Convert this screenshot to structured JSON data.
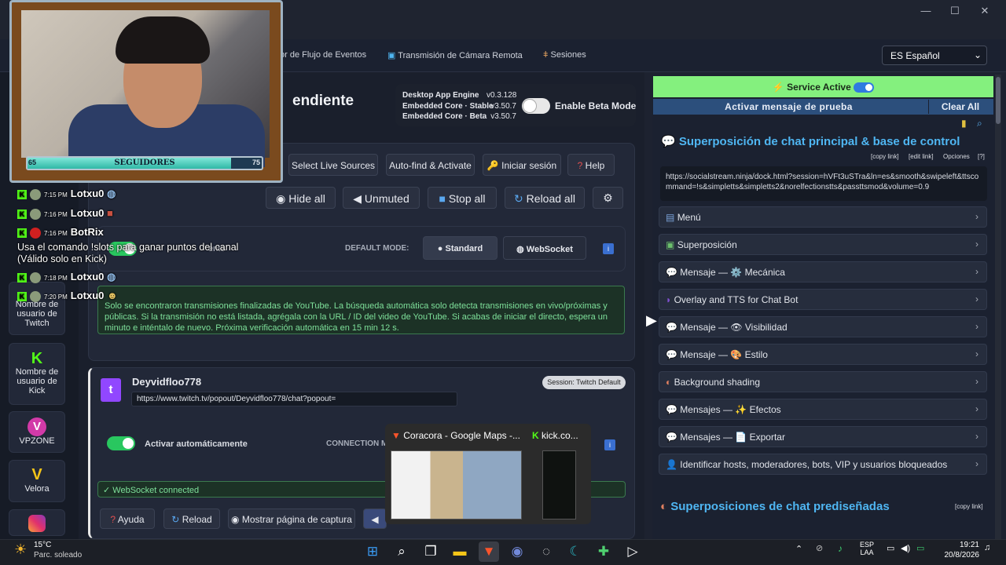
{
  "window": {
    "minimize": "—",
    "maximize": "☐",
    "close": "✕"
  },
  "nav": {
    "links": [
      "or de Flujo de Eventos",
      "Transmisión de Cámara Remota",
      "Sesiones"
    ],
    "language": "ES Español"
  },
  "webcam": {
    "follow_left": "65",
    "follow_label": "SEGUIDORES",
    "follow_right": "75",
    "progress": 0.87
  },
  "sidebar": {
    "items": [
      {
        "label": "Nombre de usuario de Twitch",
        "icon": "twitch-icon"
      },
      {
        "label": "Nombre de usuario de Kick",
        "icon": "kick-icon"
      },
      {
        "label": "VPZONE",
        "icon": "vpzone-icon"
      },
      {
        "label": "Velora",
        "icon": "velora-icon"
      }
    ]
  },
  "main": {
    "page_title": "endiente",
    "engine": {
      "rows": [
        {
          "label": "Desktop App Engine",
          "version": "v0.3.128"
        },
        {
          "label": "Embedded Core · Stable",
          "version": "v3.50.7"
        },
        {
          "label": "Embedded Core · Beta",
          "version": "v3.50.7"
        }
      ],
      "beta_label": "Enable Beta Mode"
    },
    "toolbar": [
      "Select Live Sources",
      "Auto-find & Activate",
      "Iniciar sesión",
      "Help"
    ],
    "toolbar2": [
      "Hide all",
      "Unmuted",
      "Stop all",
      "Reload all"
    ],
    "auto_label": "ente",
    "default_mode_label": "DEFAULT MODE:",
    "mode_standard": "Standard",
    "mode_websocket": "WebSocket",
    "notice": "Solo se encontraron transmisiones finalizadas de YouTube. La búsqueda automática solo detecta transmisiones en vivo/próximas y públicas. Si la transmisión no está listada, agrégala con la URL / ID del video de YouTube. Si acabas de iniciar el directo, espera un minuto e inténtalo de nuevo. Próxima verificación automática en 15 min 12 s.",
    "source": {
      "name": "Deyvidfloo778",
      "session": "Session: Twitch Default",
      "url": "https://www.twitch.tv/popout/Deyvidfloo778/chat?popout=",
      "auto_activate": "Activar automáticamente",
      "connection": "CONNECTION M",
      "ws_status": "WebSocket connected",
      "actions": [
        "Ayuda",
        "Reload",
        "Mostrar página de captura"
      ]
    }
  },
  "chat": {
    "lines": [
      {
        "time": "7:15 PM",
        "user": "Lotxu0",
        "msg": ""
      },
      {
        "time": "7:16 PM",
        "user": "Lotxu0",
        "msg": ""
      },
      {
        "time": "7:16 PM",
        "user": "BotRix",
        "msg": ""
      },
      {
        "time": "",
        "user": "",
        "msg": "Usa el comando !slots para ganar puntos del canal (Válido solo en Kick)"
      },
      {
        "time": "7:18 PM",
        "user": "Lotxu0",
        "msg": ""
      },
      {
        "time": "7:20 PM",
        "user": "Lotxu0",
        "msg": ""
      }
    ]
  },
  "right": {
    "service": "Service Active",
    "test_message": "Activar mensaje de prueba",
    "clear_all": "Clear All",
    "section1_title": "Superposición de chat principal & base de control",
    "links": [
      "[copy link]",
      "[edit link]",
      "Opciones",
      "[?]"
    ],
    "dock_url": "https://socialstream.ninja/dock.html?session=hVFt3uSTra&ln=es&smooth&swipeleft&ttscommand=!s&simpletts&simpletts2&norelfectionstts&passttsmod&volume=0.9",
    "accordion": [
      "Menú",
      "Superposición",
      "Mensaje — ⚙️ Mecánica",
      "Overlay and TTS for Chat Bot",
      "Mensaje — 👁 Visibilidad",
      "Mensaje — 🎨 Estilo",
      "Background shading",
      "Mensajes — ✨ Efectos",
      "Mensajes — 📄 Exportar",
      "Identificar hosts, moderadores, bots, VIP y usuarios bloqueados"
    ],
    "section2_title": "Superposiciones de chat prediseñadas",
    "section2_link": "[copy link]"
  },
  "preview": {
    "tab1": "Coracora - Google Maps -...",
    "tab2": "kick.co..."
  },
  "taskbar": {
    "weather_temp": "15°C",
    "weather_desc": "Parc. soleado",
    "lang1": "ESP",
    "lang2": "LAA",
    "time": "19:21",
    "date": "20/8/2026"
  }
}
